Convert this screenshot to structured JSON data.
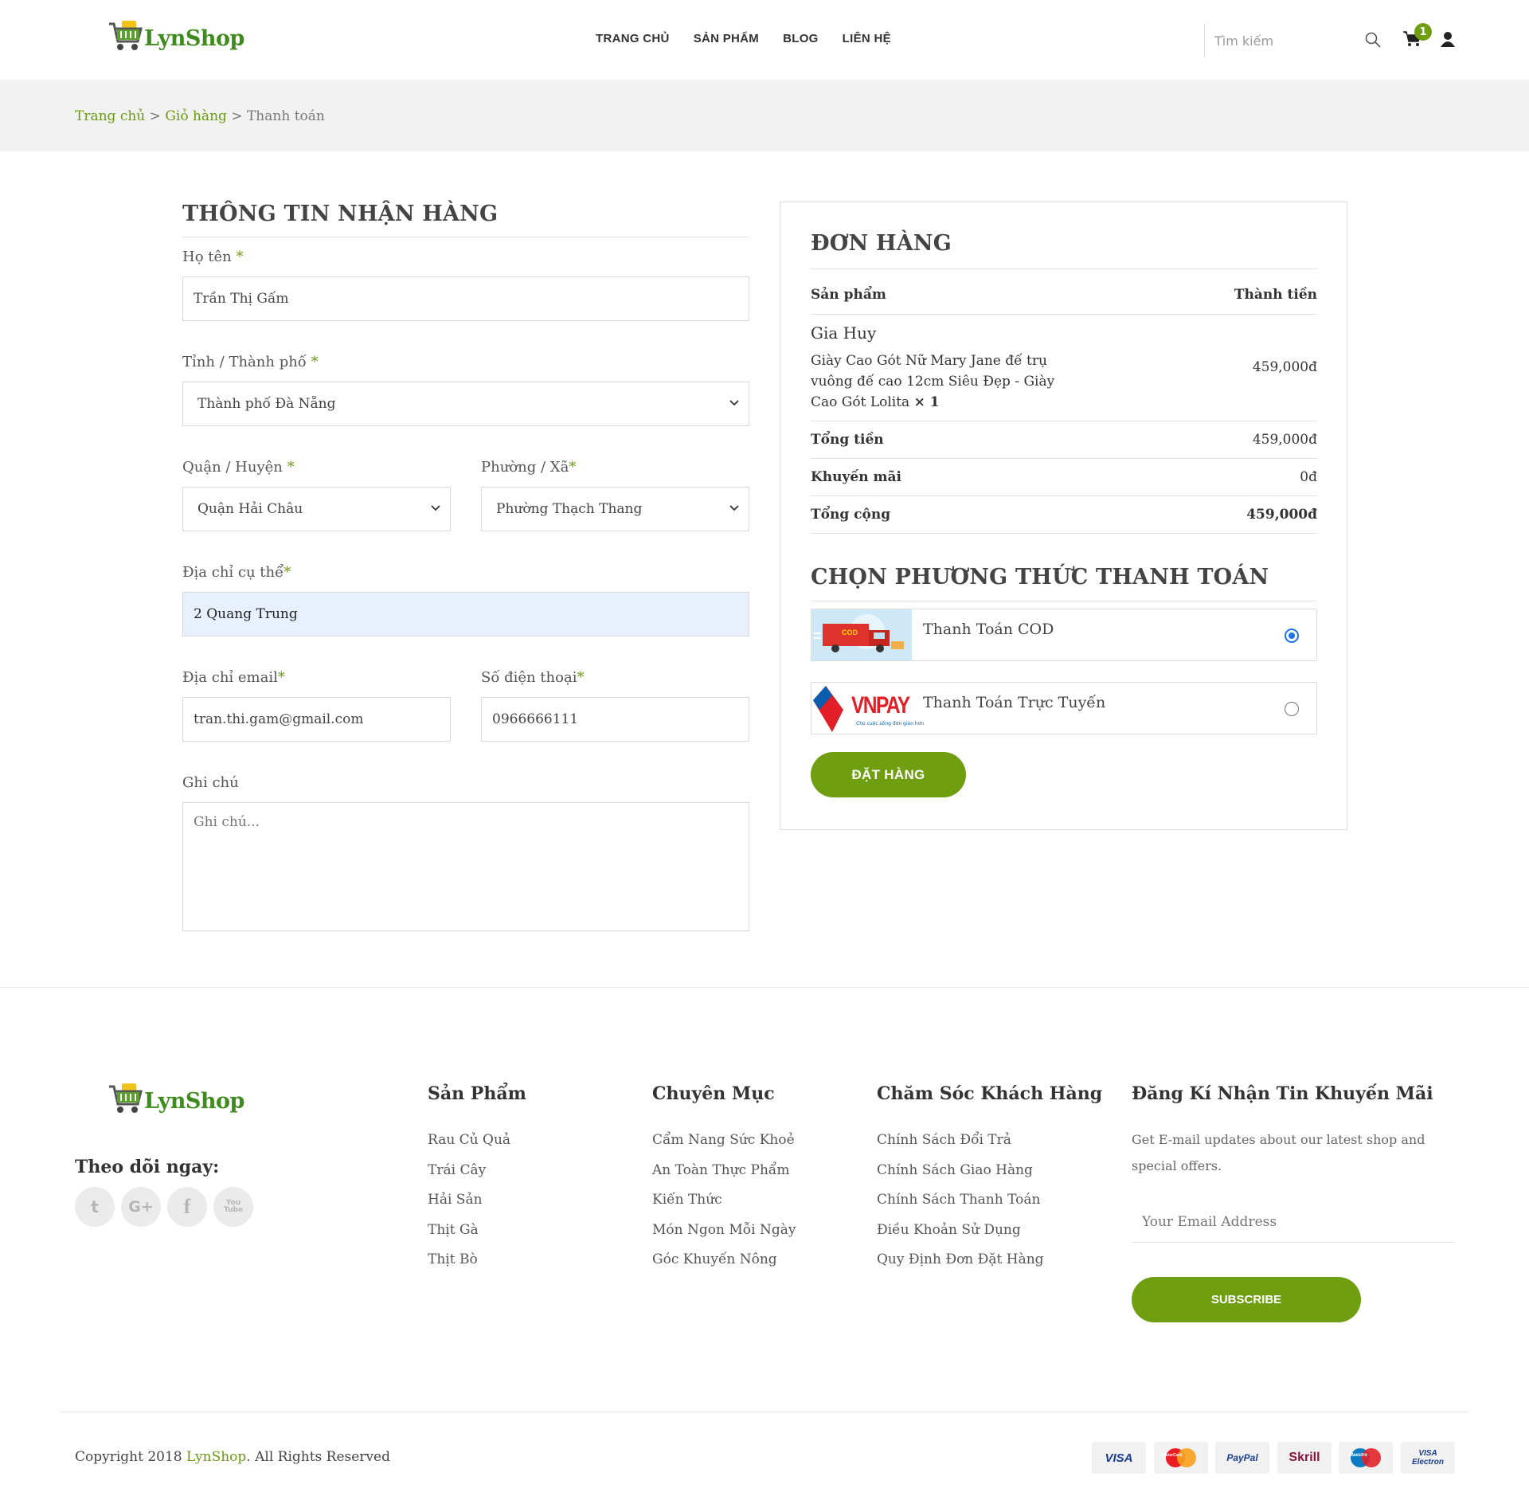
{
  "brand": {
    "name": "LynShop",
    "accent": "#6f9f10",
    "logo_green": "#3f8b1e"
  },
  "header": {
    "nav": [
      "TRANG CHỦ",
      "SẢN PHẨM",
      "BLOG",
      "LIÊN HỆ"
    ],
    "search_placeholder": "Tìm kiếm",
    "cart_count": "1",
    "icons": [
      "search-icon",
      "cart-icon",
      "user-icon"
    ]
  },
  "breadcrumb": {
    "home": "Trang chủ",
    "cart": "Giỏ hàng",
    "current": "Thanh toán",
    "sep": " > "
  },
  "form": {
    "title": "THÔNG TIN NHẬN HÀNG",
    "name_label": "Họ tên",
    "name_value": "Trần Thị Gấm",
    "city_label": "Tỉnh / Thành phố",
    "city_value": "Thành phố Đà Nẵng",
    "district_label": "Quận / Huyện",
    "district_value": "Quận Hải Châu",
    "ward_label": "Phường / Xã",
    "ward_value": "Phường Thạch Thang",
    "address_label": "Địa chỉ cụ thể",
    "address_value": "2 Quang Trung",
    "email_label": "Địa chỉ email",
    "email_value": "tran.thi.gam@gmail.com",
    "phone_label": "Số điện thoại",
    "phone_value": "0966666111",
    "note_label": "Ghi chú",
    "note_placeholder": "Ghi chú...",
    "required_mark": "*"
  },
  "order": {
    "title": "ĐƠN HÀNG",
    "col_product": "Sản phẩm",
    "col_total": "Thành tiền",
    "customer": "Gia Huy",
    "item_line1": "Giày Cao Gót Nữ Mary Jane đế trụ",
    "item_line2": "vuông đế cao 12cm Siêu Đẹp - Giày",
    "item_line3": "Cao Gót Lolita",
    "item_qty": "× 1",
    "item_price": "459,000đ",
    "subtotal_label": "Tổng tiền",
    "subtotal_value": "459,000đ",
    "discount_label": "Khuyến mãi",
    "discount_value": "0đ",
    "total_label": "Tổng cộng",
    "total_value": "459,000đ",
    "payment_title": "CHỌN PHƯƠNG THỨC THANH TOÁN",
    "pay_cod": "Thanh Toán COD",
    "pay_cod_selected": true,
    "cod_badge": "COD",
    "pay_online": "Thanh Toán Trực Tuyến",
    "vnpay_logo": "VNPAY",
    "vnpay_tagline": "Cho cuộc sống đơn giản hơn",
    "submit": "ĐẶT HÀNG"
  },
  "footer": {
    "follow": "Theo dõi ngay:",
    "social": [
      "twitter-icon",
      "google-plus-icon",
      "facebook-icon",
      "youtube-icon"
    ],
    "social_glyphs": [
      "t",
      "G+",
      "f",
      "You Tube"
    ],
    "col1_title": "Sản Phẩm",
    "col1": [
      "Rau Củ Quả",
      "Trái Cây",
      "Hải Sản",
      "Thịt Gà",
      "Thịt Bò"
    ],
    "col2_title": "Chuyên Mục",
    "col2": [
      "Cẩm Nang Sức Khoẻ",
      "An Toàn Thực Phẩm",
      "Kiến Thức",
      "Món Ngon Mỗi Ngày",
      "Góc Khuyến Nông"
    ],
    "col3_title": "Chăm Sóc Khách Hàng",
    "col3": [
      "Chính Sách Đổi Trả",
      "Chính Sách Giao Hàng",
      "Chính Sách Thanh Toán",
      "Điều Khoản Sử Dụng",
      "Quy Định Đơn Đặt Hàng"
    ],
    "newsletter_title": "Đăng Kí Nhận Tin Khuyến Mãi",
    "newsletter_text_1": "Get E-mail updates about our latest shop and",
    "newsletter_text_2": "special offers.",
    "email_placeholder": "Your Email Address",
    "subscribe": "SUBSCRIBE",
    "copyright_pre": "Copyright 2018 ",
    "copyright_brand": "LynShop",
    "copyright_post": ". All Rights Reserved",
    "payment_cards": [
      "VISA",
      "MasterCard",
      "PayPal",
      "Skrill",
      "Maestro",
      "VISA Electron"
    ]
  }
}
